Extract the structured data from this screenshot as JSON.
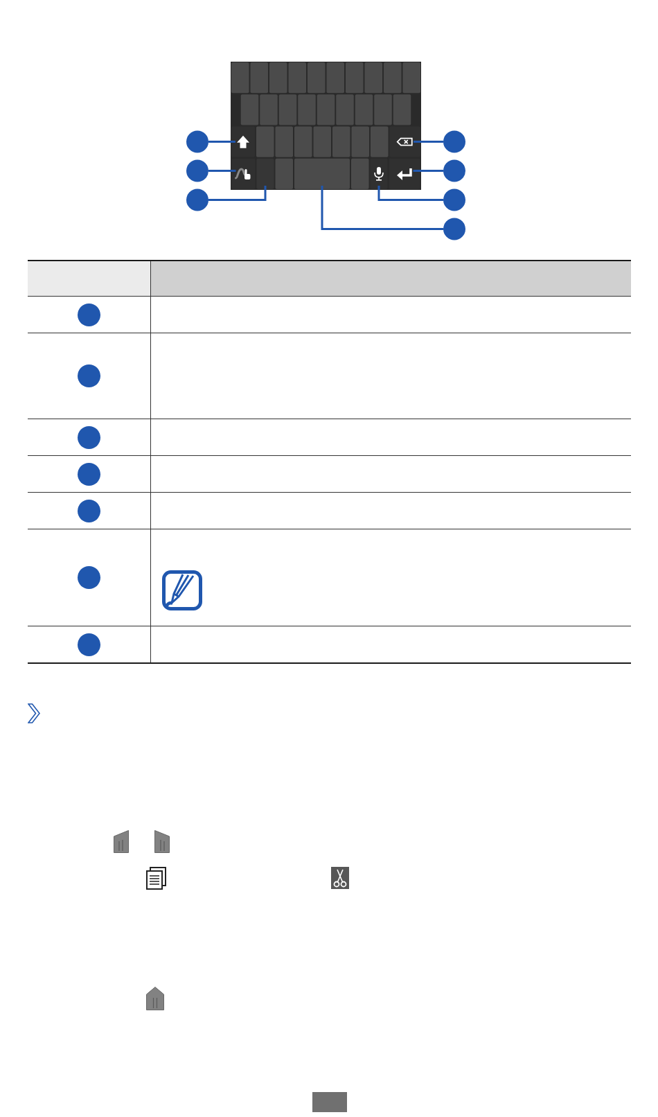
{
  "figure": {
    "keyboard": {
      "rows": [
        {
          "keys": [
            {
              "kind": "letter"
            },
            {
              "kind": "letter"
            },
            {
              "kind": "letter"
            },
            {
              "kind": "letter"
            },
            {
              "kind": "letter"
            },
            {
              "kind": "letter"
            },
            {
              "kind": "letter"
            },
            {
              "kind": "letter"
            },
            {
              "kind": "letter"
            },
            {
              "kind": "letter"
            }
          ]
        },
        {
          "keys": [
            {
              "kind": "letter"
            },
            {
              "kind": "letter"
            },
            {
              "kind": "letter"
            },
            {
              "kind": "letter"
            },
            {
              "kind": "letter"
            },
            {
              "kind": "letter"
            },
            {
              "kind": "letter"
            },
            {
              "kind": "letter"
            },
            {
              "kind": "letter"
            }
          ]
        },
        {
          "keys": [
            {
              "kind": "shift",
              "callout": {
                "kind": "left"
              }
            },
            {
              "kind": "letter"
            },
            {
              "kind": "letter"
            },
            {
              "kind": "letter"
            },
            {
              "kind": "letter"
            },
            {
              "kind": "letter"
            },
            {
              "kind": "letter"
            },
            {
              "kind": "letter"
            },
            {
              "kind": "backspace",
              "callout": {
                "kind": "right"
              }
            }
          ]
        },
        {
          "keys": [
            {
              "kind": "handwriting",
              "callout": {
                "kind": "left"
              }
            },
            {
              "kind": "symbol",
              "callout": {
                "kind": "left"
              }
            },
            {
              "kind": "letter"
            },
            {
              "kind": "space",
              "callout": {
                "kind": "right"
              }
            },
            {
              "kind": "letter"
            },
            {
              "kind": "mic",
              "callout": {
                "kind": "right"
              }
            },
            {
              "kind": "enter",
              "callout": {
                "kind": "right"
              }
            }
          ]
        }
      ]
    }
  },
  "table": {
    "header": true,
    "rows": [
      {
        "kind": "short"
      },
      {
        "kind": "long"
      },
      {
        "kind": "short"
      },
      {
        "kind": "short"
      },
      {
        "kind": "short"
      },
      {
        "kind": "note"
      },
      {
        "kind": "short"
      }
    ]
  },
  "section": {
    "heading": {
      "kind": "chevron"
    },
    "lines": [
      {
        "icons": [
          {
            "kind": "leftslant"
          },
          {
            "kind": "rightslant"
          }
        ]
      },
      {
        "icons": [
          {
            "kind": "document"
          },
          {
            "kind": "scissors"
          }
        ]
      },
      {
        "icons": [
          {
            "kind": "pointed"
          }
        ]
      }
    ]
  },
  "footer": {
    "page_tab": true
  }
}
